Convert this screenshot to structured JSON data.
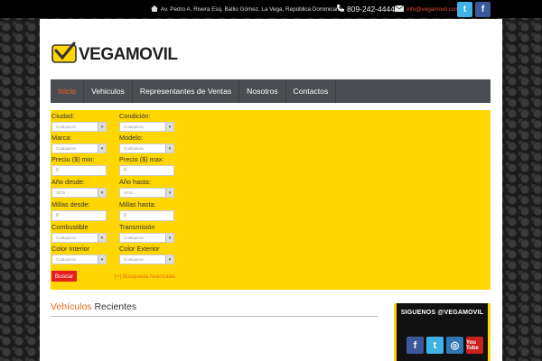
{
  "topbar": {
    "address": "Av. Pedro A. Rivera Esq. Ballio Gómez, La Vega, República Dominicana.",
    "phone": "809-242-4444",
    "email": "info@vegamovil.com",
    "social": {
      "twitter": "t",
      "facebook": "f"
    }
  },
  "logo": {
    "text": "VEGAMOVIL"
  },
  "nav": {
    "items": [
      "Inicio",
      "Vehiculos",
      "Representantes de Ventas",
      "Nosotros",
      "Contactos"
    ],
    "active_index": 0
  },
  "search": {
    "ciudad": {
      "label": "Ciudad:",
      "value": "Cualquiera"
    },
    "condicion": {
      "label": "Condición:",
      "value": "Cualquiera"
    },
    "marca": {
      "label": "Marca:",
      "value": "Cualquiera"
    },
    "modelo": {
      "label": "Modelo:",
      "value": "Cualquiera"
    },
    "precio_min": {
      "label": "Precio ($) min:",
      "value": "0"
    },
    "precio_max": {
      "label": "Precio ($) max:",
      "value": "0"
    },
    "anio_desde": {
      "label": "Año desde:",
      "value": "1975"
    },
    "anio_hasta": {
      "label": "Año hasta:",
      "value": "2016"
    },
    "millas_desde": {
      "label": "Millas desde:",
      "value": "0"
    },
    "millas_hasta": {
      "label": "Millas hasta:",
      "value": "0"
    },
    "combustible": {
      "label": "Combustible",
      "value": "Cualquiera"
    },
    "transmision": {
      "label": "Transmisión",
      "value": "Cualquiera"
    },
    "color_interior": {
      "label": "Color Interior",
      "value": "Cualquiera"
    },
    "color_exterior": {
      "label": "Color Exterior",
      "value": "Cualquiera"
    },
    "button_label": "Buscar",
    "advanced_link": "[+] Búsqueda Avanzada"
  },
  "recent": {
    "accent": "Vehículos",
    "rest": " Recientes"
  },
  "follow": {
    "title": "SIGUENOS @VEGAMOVIL",
    "icons": [
      "f",
      "t",
      "◎",
      "You Tube"
    ]
  },
  "colors": {
    "accent": "#e86a1f",
    "form_bg": "#ffd600",
    "nav_bg": "#4a4d51",
    "button": "#e81d1d"
  }
}
